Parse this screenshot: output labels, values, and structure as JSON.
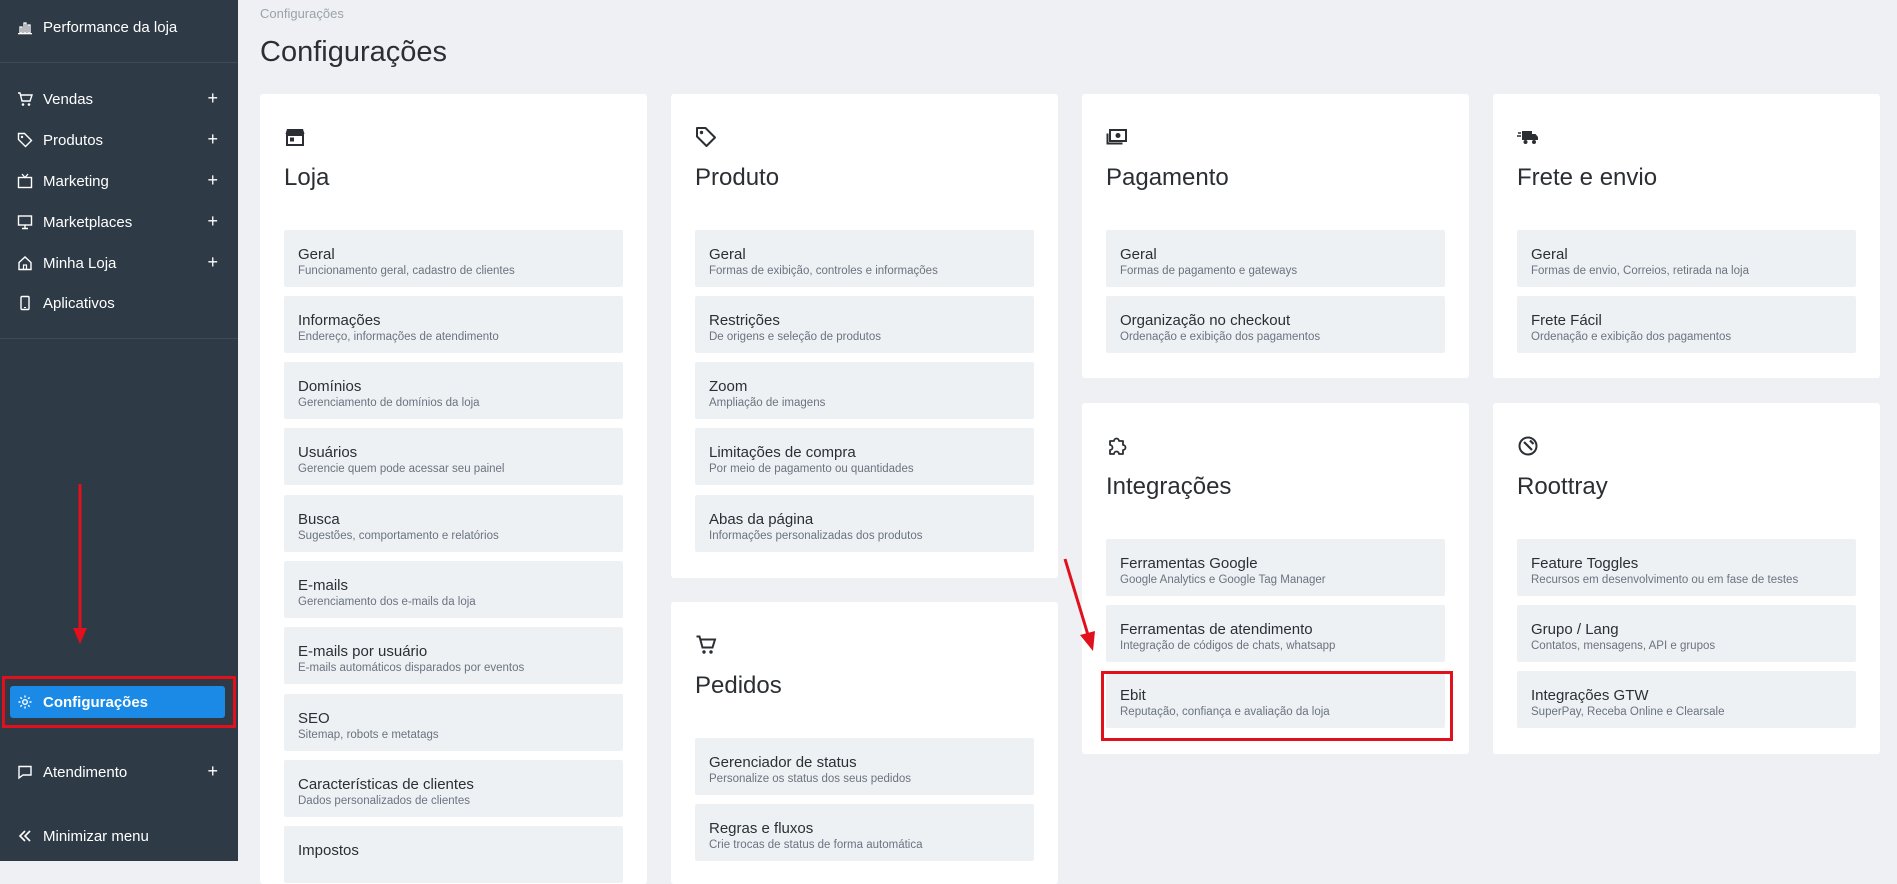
{
  "sidebar": {
    "performance_label": "Performance da loja",
    "items": [
      {
        "label": "Vendas",
        "icon": "cart-icon",
        "has_plus": true
      },
      {
        "label": "Produtos",
        "icon": "tag-icon",
        "has_plus": true
      },
      {
        "label": "Marketing",
        "icon": "tv-icon",
        "has_plus": true
      },
      {
        "label": "Marketplaces",
        "icon": "monitor-icon",
        "has_plus": true
      },
      {
        "label": "Minha Loja",
        "icon": "home-icon",
        "has_plus": true
      },
      {
        "label": "Aplicativos",
        "icon": "phone-icon",
        "has_plus": false
      }
    ],
    "plus_symbol": "+",
    "config_label": "Configurações",
    "atendimento_label": "Atendimento",
    "minimize_label": "Minimizar menu",
    "active_color": "#1a8ae6",
    "bg_color": "#2e3a45"
  },
  "breadcrumb": "Configurações",
  "page_title": "Configurações",
  "highlight_color": "#e0101c",
  "cards": {
    "loja": {
      "title": "Loja",
      "icon": "store-icon",
      "rows": [
        {
          "title": "Geral",
          "desc": "Funcionamento geral, cadastro de clientes"
        },
        {
          "title": "Informações",
          "desc": "Endereço, informações de atendimento"
        },
        {
          "title": "Domínios",
          "desc": "Gerenciamento de domínios da loja"
        },
        {
          "title": "Usuários",
          "desc": "Gerencie quem pode acessar seu painel"
        },
        {
          "title": "Busca",
          "desc": "Sugestões, comportamento e relatórios"
        },
        {
          "title": "E-mails",
          "desc": "Gerenciamento dos e-mails da loja"
        },
        {
          "title": "E-mails por usuário",
          "desc": "E-mails automáticos disparados por eventos"
        },
        {
          "title": "SEO",
          "desc": "Sitemap, robots e metatags"
        },
        {
          "title": "Características de clientes",
          "desc": "Dados personalizados de clientes"
        },
        {
          "title": "Impostos",
          "desc": ""
        }
      ]
    },
    "produto": {
      "title": "Produto",
      "icon": "tag-icon",
      "rows": [
        {
          "title": "Geral",
          "desc": "Formas de exibição, controles e informações"
        },
        {
          "title": "Restrições",
          "desc": "De origens e seleção de produtos"
        },
        {
          "title": "Zoom",
          "desc": "Ampliação de imagens"
        },
        {
          "title": "Limitações de compra",
          "desc": "Por meio de pagamento ou quantidades"
        },
        {
          "title": "Abas da página",
          "desc": "Informações personalizadas dos produtos"
        }
      ]
    },
    "pedidos": {
      "title": "Pedidos",
      "icon": "cart-icon",
      "rows": [
        {
          "title": "Gerenciador de status",
          "desc": "Personalize os status dos seus pedidos"
        },
        {
          "title": "Regras e fluxos",
          "desc": "Crie trocas de status de forma automática"
        }
      ]
    },
    "pagamento": {
      "title": "Pagamento",
      "icon": "money-icon",
      "rows": [
        {
          "title": "Geral",
          "desc": "Formas de pagamento e gateways"
        },
        {
          "title": "Organização no checkout",
          "desc": "Ordenação e exibição dos pagamentos"
        }
      ]
    },
    "frete": {
      "title": "Frete e envio",
      "icon": "truck-icon",
      "rows": [
        {
          "title": "Geral",
          "desc": "Formas de envio, Correios, retirada na loja"
        },
        {
          "title": "Frete Fácil",
          "desc": "Ordenação e exibição dos pagamentos"
        }
      ]
    },
    "integracoes": {
      "title": "Integrações",
      "icon": "puzzle-icon",
      "rows": [
        {
          "title": "Ferramentas Google",
          "desc": "Google Analytics e Google Tag Manager"
        },
        {
          "title": "Ferramentas de atendimento",
          "desc": "Integração de códigos de chats, whatsapp"
        },
        {
          "title": "Ebit",
          "desc": "Reputação, confiança e avaliação da loja"
        }
      ]
    },
    "roottray": {
      "title": "Roottray",
      "icon": "tools-icon",
      "rows": [
        {
          "title": "Feature Toggles",
          "desc": "Recursos em desenvolvimento ou em fase de testes"
        },
        {
          "title": "Grupo / Lang",
          "desc": "Contatos, mensagens, API e grupos"
        },
        {
          "title": "Integrações GTW",
          "desc": "SuperPay, Receba Online e Clearsale"
        }
      ]
    }
  }
}
